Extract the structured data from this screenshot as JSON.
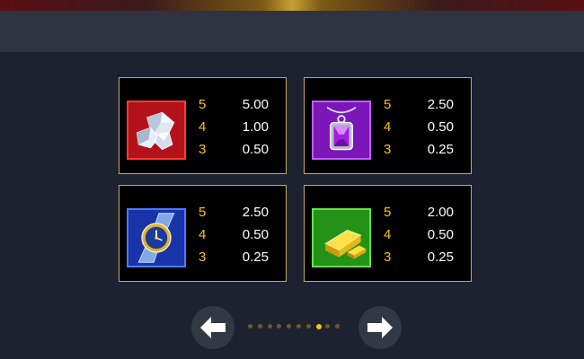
{
  "colors": {
    "accent_gold": "#ffc20e",
    "card_border": "#c8a860",
    "card_background": "#000000",
    "page_background": "#1d2231"
  },
  "paytable": {
    "cards": [
      {
        "symbol": "diamond-icon",
        "tile_color": "#c8141b",
        "rows": [
          {
            "count": "5",
            "value": "5.00"
          },
          {
            "count": "4",
            "value": "1.00"
          },
          {
            "count": "3",
            "value": "0.50"
          }
        ]
      },
      {
        "symbol": "amethyst-pendant-icon",
        "tile_color": "#8a1fc9",
        "rows": [
          {
            "count": "5",
            "value": "2.50"
          },
          {
            "count": "4",
            "value": "0.50"
          },
          {
            "count": "3",
            "value": "0.25"
          }
        ]
      },
      {
        "symbol": "gold-watch-icon",
        "tile_color": "#1c3fc7",
        "rows": [
          {
            "count": "5",
            "value": "2.50"
          },
          {
            "count": "4",
            "value": "0.50"
          },
          {
            "count": "3",
            "value": "0.25"
          }
        ]
      },
      {
        "symbol": "gold-bars-icon",
        "tile_color": "#2eaa1e",
        "rows": [
          {
            "count": "5",
            "value": "2.00"
          },
          {
            "count": "4",
            "value": "0.50"
          },
          {
            "count": "3",
            "value": "0.25"
          }
        ]
      }
    ]
  },
  "pagination": {
    "prev_icon": "arrow-left-icon",
    "next_icon": "arrow-right-icon",
    "page_count": 10,
    "active_page": 8
  }
}
